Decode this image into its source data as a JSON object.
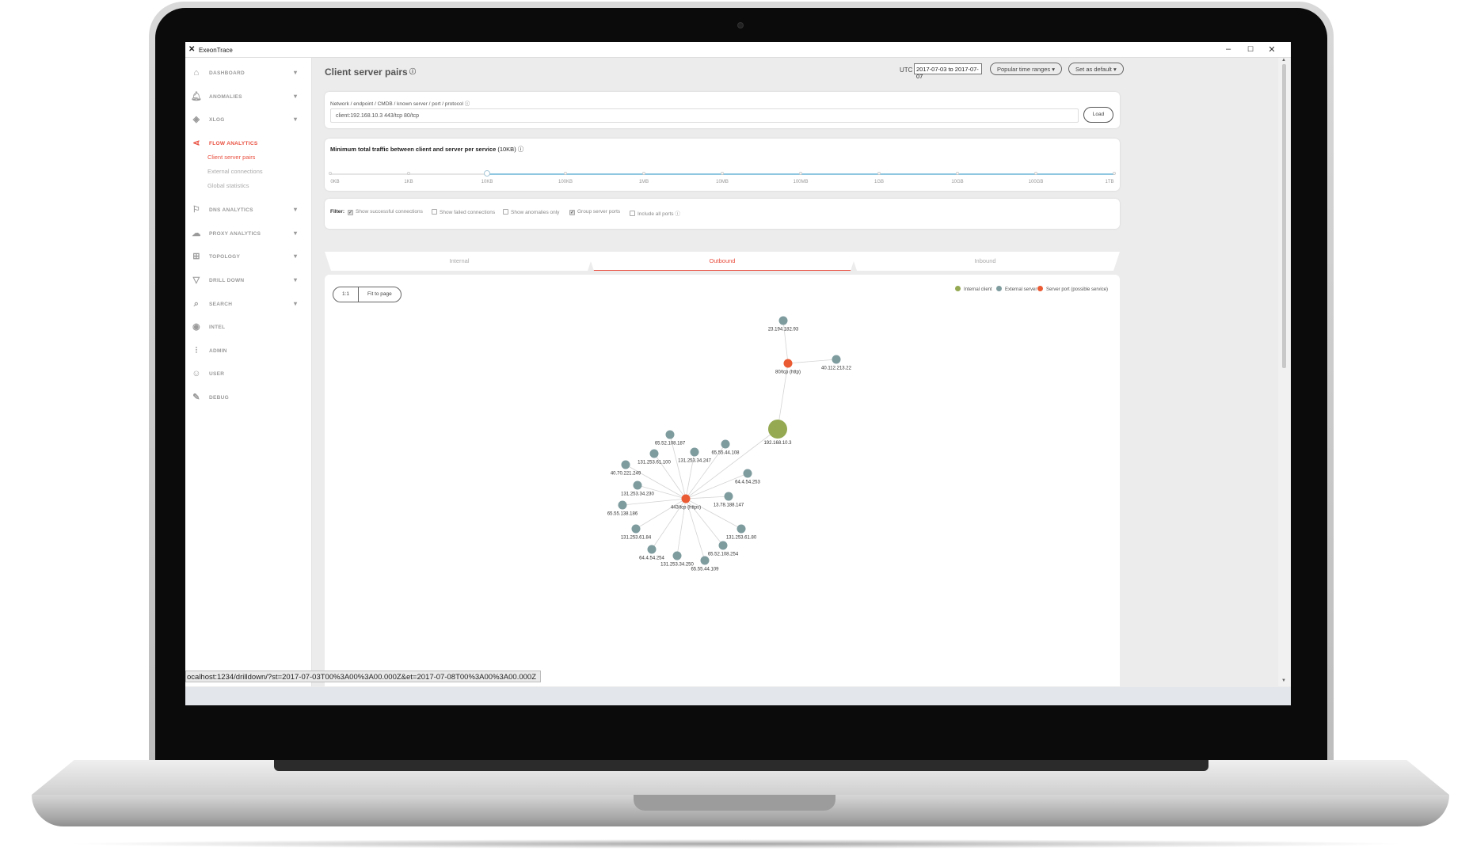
{
  "app": {
    "window_title": "ExeonTrace",
    "brand": "exeon"
  },
  "sidebar": {
    "items": [
      {
        "label": "DASHBOARD",
        "icon": "home-icon",
        "chevron": true
      },
      {
        "label": "ANOMALIES",
        "icon": "bell-icon",
        "chevron": true
      },
      {
        "label": "XLOG",
        "icon": "database-icon",
        "chevron": true
      },
      {
        "label": "FLOW ANALYTICS",
        "icon": "share-icon",
        "chevron": false,
        "active": true
      },
      {
        "label": "DNS ANALYTICS",
        "icon": "signpost-icon",
        "chevron": true
      },
      {
        "label": "PROXY ANALYTICS",
        "icon": "cloud-icon",
        "chevron": true
      },
      {
        "label": "TOPOLOGY",
        "icon": "sitemap-icon",
        "chevron": true
      },
      {
        "label": "DRILL DOWN",
        "icon": "filter-icon",
        "chevron": true
      },
      {
        "label": "SEARCH",
        "icon": "search-icon",
        "chevron": true
      },
      {
        "label": "INTEL",
        "icon": "eye-icon",
        "chevron": false
      },
      {
        "label": "ADMIN",
        "icon": "sliders-icon",
        "chevron": false
      },
      {
        "label": "USER",
        "icon": "user-icon",
        "chevron": false
      },
      {
        "label": "DEBUG",
        "icon": "pin-icon",
        "chevron": false
      }
    ],
    "subitems": [
      {
        "label": "Client server pairs",
        "active": true
      },
      {
        "label": "External connections",
        "active": false
      },
      {
        "label": "Global statistics",
        "active": false
      }
    ]
  },
  "status_url": "ocalhost:1234/drilldown/?st=2017-07-03T00%3A00%3A00.000Z&et=2017-07-08T00%3A00%3A00.000Z",
  "header": {
    "title": "Client server pairs",
    "utc_label": "UTC",
    "date_range": "2017-07-03 to 2017-07-07",
    "time_ranges_button": "Popular time ranges",
    "default_button": "Set as default"
  },
  "query": {
    "label": "Network / endpoint / CMDB / known server / port / protocol",
    "value": "client:192.168.10.3 443/tcp 80/tcp",
    "load_button": "Load"
  },
  "slider": {
    "title": "Minimum total traffic between client and server per service",
    "current": "(10KB)",
    "ticks": [
      "0KB",
      "1KB",
      "10KB",
      "100KB",
      "1MB",
      "10MB",
      "100MB",
      "1GB",
      "10GB",
      "100GB",
      "1TB"
    ],
    "selected": "10KB"
  },
  "filters": {
    "label": "Filter:",
    "options": [
      {
        "label": "Show successful connections",
        "checked": true
      },
      {
        "label": "Show failed connections",
        "checked": false
      },
      {
        "label": "Show anomalies only",
        "checked": false
      },
      {
        "label": "Group server ports",
        "checked": true
      },
      {
        "label": "Include all ports",
        "checked": false
      }
    ]
  },
  "tabs": [
    {
      "label": "Internal",
      "active": false
    },
    {
      "label": "Outbound",
      "active": true
    },
    {
      "label": "Inbound",
      "active": false
    }
  ],
  "graph": {
    "zoom_buttons": [
      "1:1",
      "Fit to page"
    ],
    "legend": [
      {
        "label": "Internal client",
        "color": "#94a952"
      },
      {
        "label": "External server",
        "color": "#7e9b9e"
      },
      {
        "label": "Server port (possible service)",
        "color": "#ea5a33"
      }
    ],
    "nodes": [
      {
        "id": "c",
        "label": "192.168.10.3",
        "type": "internal"
      },
      {
        "id": "p80",
        "label": "80/tcp (http)",
        "type": "port"
      },
      {
        "id": "p443",
        "label": "443/tcp (https)",
        "type": "port"
      },
      {
        "id": "s1",
        "label": "23.194.182.93",
        "type": "external"
      },
      {
        "id": "s2",
        "label": "40.112.213.22",
        "type": "external"
      },
      {
        "id": "s3",
        "label": "65.52.108.187",
        "type": "external"
      },
      {
        "id": "s4",
        "label": "65.55.44.108",
        "type": "external"
      },
      {
        "id": "s5",
        "label": "131.253.61.100",
        "type": "external"
      },
      {
        "id": "s6",
        "label": "131.253.34.247",
        "type": "external"
      },
      {
        "id": "s7",
        "label": "40.70.221.249",
        "type": "external"
      },
      {
        "id": "s8",
        "label": "64.4.54.253",
        "type": "external"
      },
      {
        "id": "s9",
        "label": "131.253.34.230",
        "type": "external"
      },
      {
        "id": "s10",
        "label": "13.78.188.147",
        "type": "external"
      },
      {
        "id": "s11",
        "label": "65.55.138.186",
        "type": "external"
      },
      {
        "id": "s12",
        "label": "131.253.61.84",
        "type": "external"
      },
      {
        "id": "s13",
        "label": "131.253.61.80",
        "type": "external"
      },
      {
        "id": "s14",
        "label": "65.52.108.254",
        "type": "external"
      },
      {
        "id": "s15",
        "label": "64.4.54.254",
        "type": "external"
      },
      {
        "id": "s16",
        "label": "131.253.34.250",
        "type": "external"
      },
      {
        "id": "s17",
        "label": "65.55.44.109",
        "type": "external"
      }
    ],
    "edges": [
      [
        "c",
        "p80"
      ],
      [
        "c",
        "p443"
      ],
      [
        "p80",
        "s1"
      ],
      [
        "p80",
        "s2"
      ],
      [
        "p443",
        "s3"
      ],
      [
        "p443",
        "s4"
      ],
      [
        "p443",
        "s5"
      ],
      [
        "p443",
        "s6"
      ],
      [
        "p443",
        "s7"
      ],
      [
        "p443",
        "s8"
      ],
      [
        "p443",
        "s9"
      ],
      [
        "p443",
        "s10"
      ],
      [
        "p443",
        "s11"
      ],
      [
        "p443",
        "s12"
      ],
      [
        "p443",
        "s13"
      ],
      [
        "p443",
        "s14"
      ],
      [
        "p443",
        "s15"
      ],
      [
        "p443",
        "s16"
      ],
      [
        "p443",
        "s17"
      ]
    ]
  }
}
